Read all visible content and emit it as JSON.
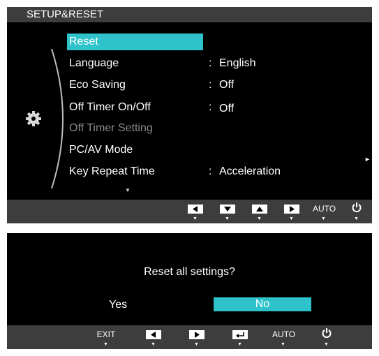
{
  "menu": {
    "title": "SETUP&RESET",
    "items": [
      {
        "label": "Reset",
        "value": "",
        "colon": "",
        "state": "selected"
      },
      {
        "label": "Language",
        "value": "English",
        "colon": ":"
      },
      {
        "label": "Eco Saving",
        "value": "Off",
        "colon": ":"
      },
      {
        "label": "Off Timer On/Off",
        "value": "Off",
        "colon": ":"
      },
      {
        "label": "Off Timer Setting",
        "value": "",
        "colon": "",
        "state": "disabled"
      },
      {
        "label": "PC/AV Mode",
        "value": "",
        "colon": "",
        "submenu": true
      },
      {
        "label": "Key Repeat Time",
        "value": "Acceleration",
        "colon": ":"
      }
    ],
    "submenu_arrow": "►",
    "scroll_indicator": "▼",
    "nav": {
      "auto_label": "AUTO"
    }
  },
  "dialog": {
    "question": "Reset all settings?",
    "yes_label": "Yes",
    "no_label": "No",
    "selected": "No",
    "nav": {
      "exit_label": "EXIT",
      "auto_label": "AUTO"
    }
  },
  "colors": {
    "highlight": "#2ec2cb",
    "background": "#000000",
    "bar": "#3d3d3d",
    "disabled_text": "#8a8a8a"
  }
}
